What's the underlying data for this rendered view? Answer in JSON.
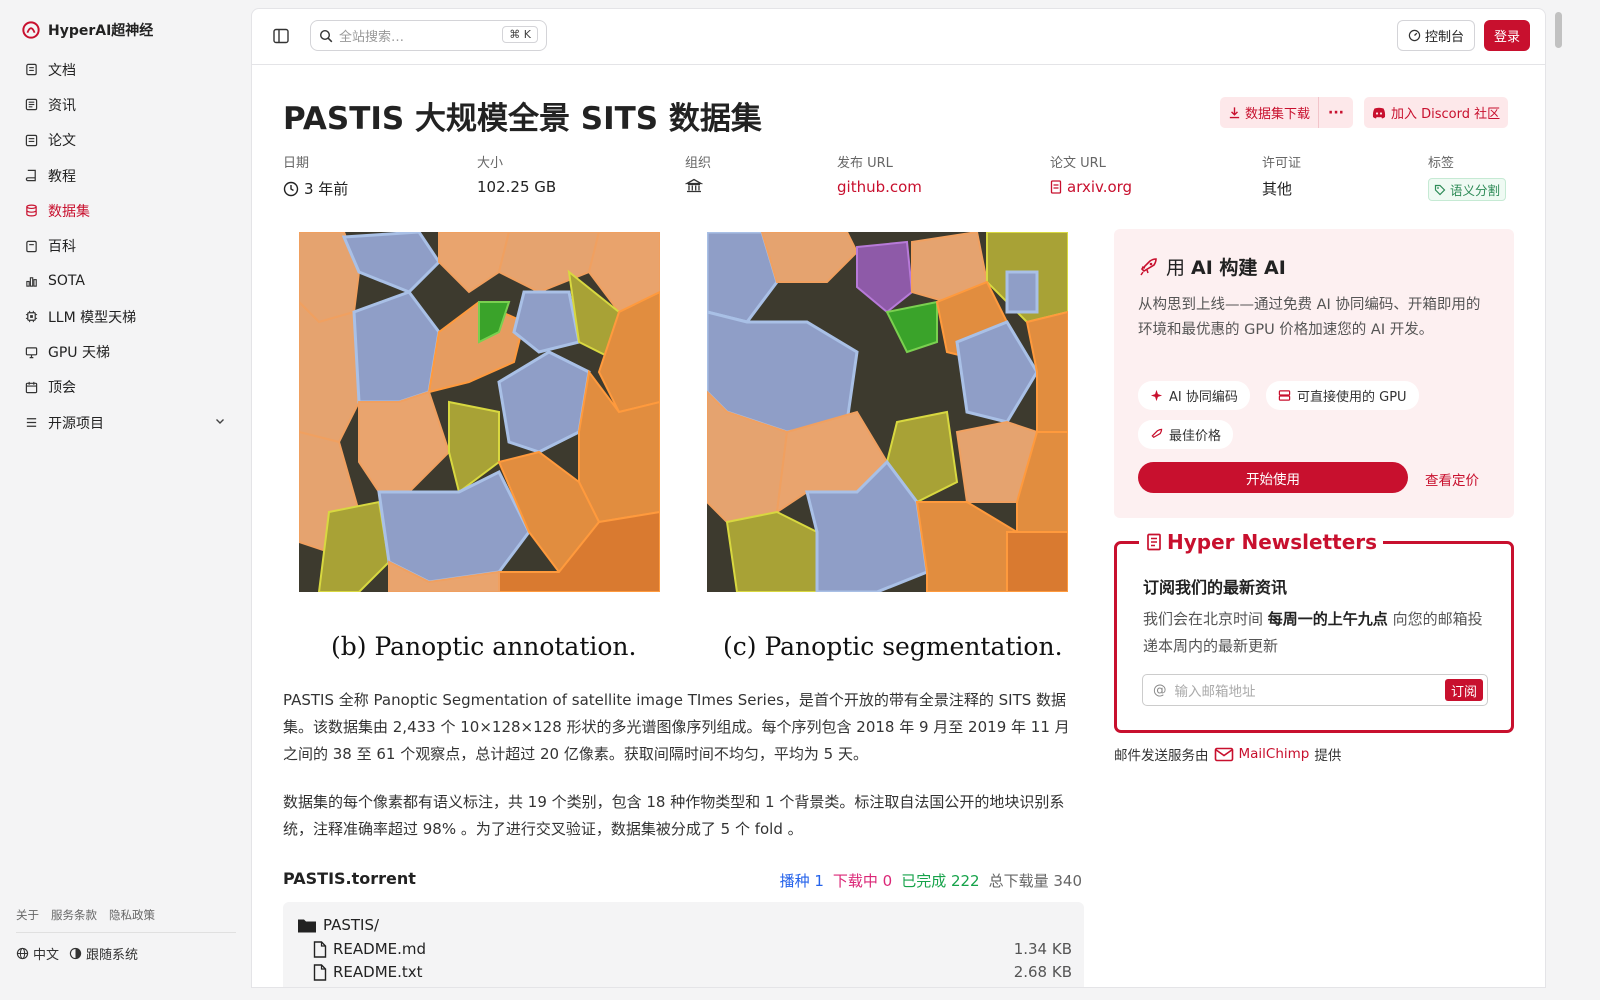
{
  "sidebar": {
    "brand": "HyperAI超神经",
    "items": [
      {
        "label": "文档",
        "icon": "document-icon"
      },
      {
        "label": "资讯",
        "icon": "news-icon"
      },
      {
        "label": "论文",
        "icon": "paper-icon"
      },
      {
        "label": "教程",
        "icon": "book-icon"
      },
      {
        "label": "数据集",
        "icon": "database-icon",
        "active": true
      },
      {
        "label": "百科",
        "icon": "wiki-icon"
      },
      {
        "label": "SOTA",
        "icon": "bar-chart-icon"
      },
      {
        "label": "LLM 模型天梯",
        "icon": "chip-icon"
      },
      {
        "label": "GPU 天梯",
        "icon": "monitor-icon"
      },
      {
        "label": "顶会",
        "icon": "calendar-icon"
      },
      {
        "label": "开源项目",
        "icon": "list-icon",
        "expandable": true
      }
    ],
    "footer_links": [
      "关于",
      "服务条款",
      "隐私政策"
    ],
    "language": "中文",
    "theme": "跟随系统"
  },
  "topbar": {
    "search_placeholder": "全站搜索…",
    "search_shortcut": "K",
    "console_label": "控制台",
    "login_label": "登录"
  },
  "dataset": {
    "title": "PASTIS 大规模全景 SITS 数据集",
    "download_label": "数据集下载",
    "more_label": "···",
    "discord_label": "加入 Discord 社区",
    "meta": {
      "date_label": "日期",
      "date_value": "3 年前",
      "size_label": "大小",
      "size_value": "102.25 GB",
      "org_label": "组织",
      "release_label": "发布 URL",
      "release_value": "github.com",
      "paper_label": "论文 URL",
      "paper_value": "arxiv.org",
      "license_label": "许可证",
      "license_value": "其他",
      "tags_label": "标签",
      "tag_value": "语义分割"
    },
    "figure": {
      "caption_b": "(b) Panoptic annotation.",
      "caption_c": "(c) Panoptic segmentation."
    },
    "description_1": "PASTIS 全称 Panoptic Segmentation of satellite image TImes Series，是首个开放的带有全景注释的 SITS 数据集。该数据集由 2,433 个 10×128×128 形状的多光谱图像序列组成。每个序列包含 2018 年 9 月至 2019 年 11 月之间的 38 至 61 个观察点，总计超过 20 亿像素。获取间隔时间不均匀，平均为 5 天。",
    "description_2": "数据集的每个像素都有语义标注，共 19 个类别，包含 18 种作物类型和 1 个背景类。标注取自法国公开的地块识别系统，注释准确率超过 98% 。为了进行交叉验证，数据集被分成了 5 个 fold 。",
    "torrent": {
      "name": "PASTIS.torrent",
      "seeding": "播种 1",
      "downloading": "下载中 0",
      "completed": "已完成 222",
      "total": "总下载量 340",
      "files": [
        {
          "name": "PASTIS/",
          "type": "folder",
          "size": ""
        },
        {
          "name": "README.md",
          "type": "file",
          "size": "1.34 KB"
        },
        {
          "name": "README.txt",
          "type": "file",
          "size": "2.68 KB"
        }
      ]
    }
  },
  "promo": {
    "title_prefix": "用 ",
    "title_bold": "AI 构建 AI",
    "text": "从构思到上线——通过免费 AI 协同编码、开箱即用的环境和最优惠的 GPU 价格加速您的 AI 开发。",
    "pills": [
      "AI 协同编码",
      "可直接使用的 GPU",
      "最佳价格"
    ],
    "start_label": "开始使用",
    "pricing_label": "查看定价"
  },
  "newsletter": {
    "title": "Hyper Newsletters",
    "heading": "订阅我们的最新资讯",
    "text_before": "我们会在北京时间 ",
    "text_bold": "每周一的上午九点",
    "text_after": " 向您的邮箱投递本周内的最新更新",
    "email_placeholder": "输入邮箱地址",
    "subscribe_label": "订阅",
    "credit_before": "邮件发送服务由",
    "credit_brand": "MailChimp",
    "credit_after": "提供"
  },
  "colors": {
    "accent": "#c8102e",
    "seed": "#2563eb",
    "downloading": "#db2777",
    "completed": "#16a34a"
  }
}
